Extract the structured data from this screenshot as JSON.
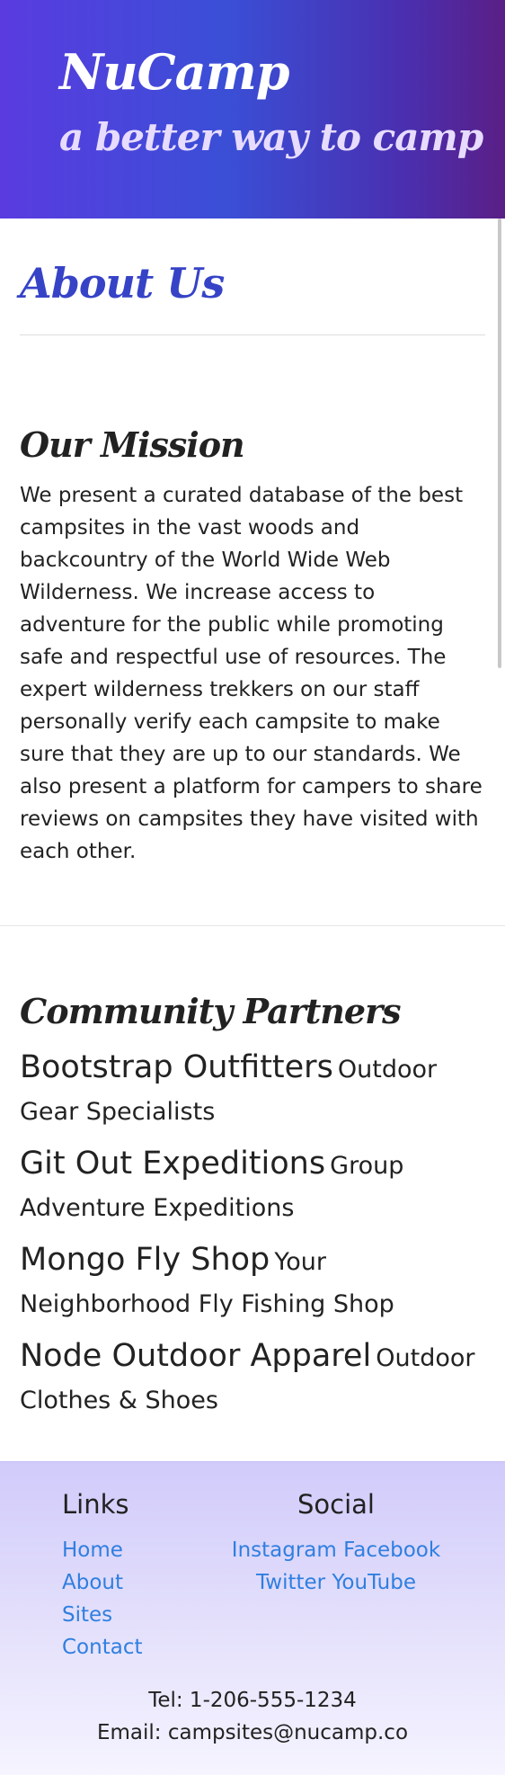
{
  "header": {
    "brand": "NuCamp",
    "tagline": "a better way to camp"
  },
  "page": {
    "title": "About Us"
  },
  "mission": {
    "heading": "Our Mission",
    "text": "We present a curated database of the best campsites in the vast woods and backcountry of the World Wide Web Wilderness. We increase access to adventure for the public while promoting safe and respectful use of resources. The expert wilderness trekkers on our staff personally verify each campsite to make sure that they are up to our standards. We also present a platform for campers to share reviews on campsites they have visited with each other."
  },
  "partners": {
    "heading": "Community Partners",
    "items": [
      {
        "name": "Bootstrap Outfitters",
        "description": "Outdoor Gear Specialists"
      },
      {
        "name": "Git Out Expeditions",
        "description": "Group Adventure Expeditions"
      },
      {
        "name": "Mongo Fly Shop",
        "description": "Your Neighborhood Fly Fishing Shop"
      },
      {
        "name": "Node Outdoor Apparel",
        "description": "Outdoor Clothes & Shoes"
      }
    ]
  },
  "footer": {
    "links_heading": "Links",
    "links": [
      "Home",
      "About",
      "Sites",
      "Contact"
    ],
    "social_heading": "Social",
    "social": [
      "Instagram",
      "Facebook",
      "Twitter",
      "YouTube"
    ],
    "tel": "Tel: 1-206-555-1234",
    "email": "Email: campsites@nucamp.co"
  },
  "colors": {
    "header_gradient_start": "#5a3be0",
    "header_gradient_end": "#5a1f86",
    "accent_title": "#3643c7",
    "link": "#2f7fe0",
    "footer_bg": "#d1cbfb"
  }
}
